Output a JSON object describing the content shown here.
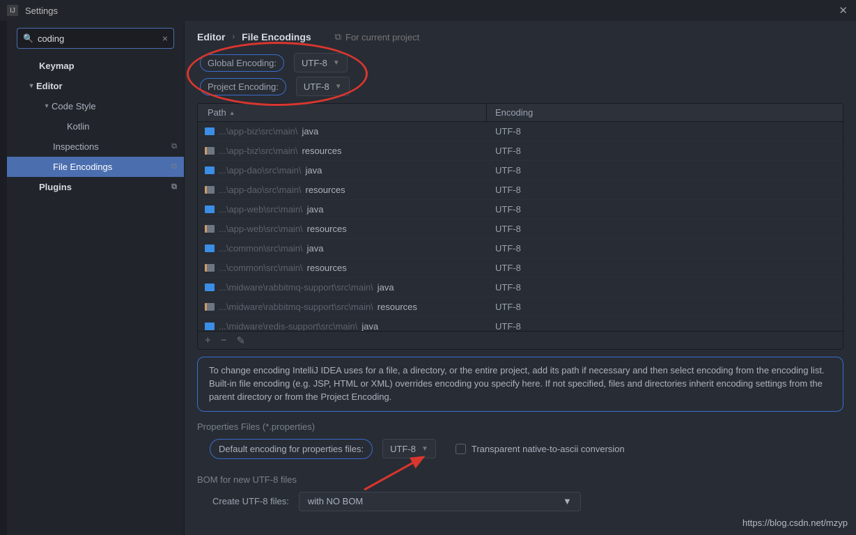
{
  "window": {
    "title": "Settings",
    "close_glyph": "✕"
  },
  "search": {
    "value": "coding",
    "placeholder": ""
  },
  "sidebar": {
    "items": [
      {
        "label": "Keymap",
        "indent": 46,
        "bold": true
      },
      {
        "label": "Editor",
        "indent": 44,
        "bold": true,
        "chev": "▾"
      },
      {
        "label": "Code Style",
        "indent": 66,
        "chev": "▾"
      },
      {
        "label": "Kotlin",
        "indent": 86
      },
      {
        "label": "Inspections",
        "indent": 66,
        "copy": true
      },
      {
        "label": "File Encodings",
        "indent": 66,
        "selected": true,
        "copy": true
      },
      {
        "label": "Plugins",
        "indent": 46,
        "bold": true,
        "copy": true
      }
    ]
  },
  "breadcrumb": {
    "a": "Editor",
    "b": "File Encodings",
    "hint": "For current project"
  },
  "encodings": {
    "global_label": "Global Encoding:",
    "global_value": "UTF-8",
    "project_label": "Project Encoding:",
    "project_value": "UTF-8"
  },
  "table": {
    "col_path": "Path",
    "col_enc": "Encoding",
    "rows": [
      {
        "gray": "...\\app-biz\\src\\main\\",
        "lite": "java",
        "enc": "UTF-8",
        "kind": "java"
      },
      {
        "gray": "...\\app-biz\\src\\main\\",
        "lite": "resources",
        "enc": "UTF-8",
        "kind": "res"
      },
      {
        "gray": "...\\app-dao\\src\\main\\",
        "lite": "java",
        "enc": "UTF-8",
        "kind": "java"
      },
      {
        "gray": "...\\app-dao\\src\\main\\",
        "lite": "resources",
        "enc": "UTF-8",
        "kind": "res"
      },
      {
        "gray": "...\\app-web\\src\\main\\",
        "lite": "java",
        "enc": "UTF-8",
        "kind": "java"
      },
      {
        "gray": "...\\app-web\\src\\main\\",
        "lite": "resources",
        "enc": "UTF-8",
        "kind": "res"
      },
      {
        "gray": "...\\common\\src\\main\\",
        "lite": "java",
        "enc": "UTF-8",
        "kind": "java"
      },
      {
        "gray": "...\\common\\src\\main\\",
        "lite": "resources",
        "enc": "UTF-8",
        "kind": "res"
      },
      {
        "gray": "...\\midware\\rabbitmq-support\\src\\main\\",
        "lite": "java",
        "enc": "UTF-8",
        "kind": "java"
      },
      {
        "gray": "...\\midware\\rabbitmq-support\\src\\main\\",
        "lite": "resources",
        "enc": "UTF-8",
        "kind": "res"
      },
      {
        "gray": "...\\midware\\redis-support\\src\\main\\",
        "lite": "java",
        "enc": "UTF-8",
        "kind": "java"
      }
    ],
    "footer": {
      "add": "+",
      "remove": "−",
      "edit": "✎"
    }
  },
  "info": "To change encoding IntelliJ IDEA uses for a file, a directory, or the entire project, add its path if necessary and then select encoding from the encoding list. Built-in file encoding (e.g. JSP, HTML or XML) overrides encoding you specify here. If not specified, files and directories inherit encoding settings from the parent directory or from the Project Encoding.",
  "properties": {
    "section": "Properties Files (*.properties)",
    "label": "Default encoding for properties files:",
    "value": "UTF-8",
    "checkbox_label": "Transparent native-to-ascii conversion"
  },
  "bom": {
    "section": "BOM for new UTF-8 files",
    "label": "Create UTF-8 files:",
    "value": "with NO BOM"
  },
  "watermark": "https://blog.csdn.net/mzyp"
}
